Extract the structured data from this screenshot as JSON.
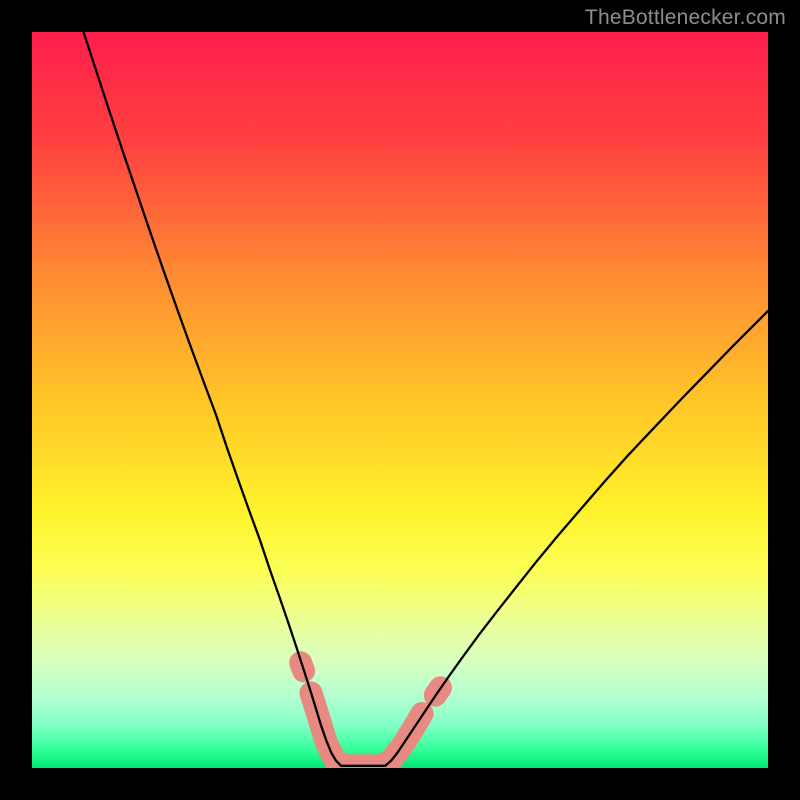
{
  "watermark": {
    "text": "TheBottlenecker.com"
  },
  "chart_data": {
    "type": "line",
    "title": "",
    "xlabel": "",
    "ylabel": "",
    "xlim": [
      0,
      100
    ],
    "ylim": [
      0,
      100
    ],
    "grid": false,
    "background": {
      "kind": "vertical-gradient",
      "stops": [
        {
          "offset": 0.0,
          "color": "#FF1E4C"
        },
        {
          "offset": 0.15,
          "color": "#FF4140"
        },
        {
          "offset": 0.33,
          "color": "#FF8A33"
        },
        {
          "offset": 0.5,
          "color": "#FFC528"
        },
        {
          "offset": 0.65,
          "color": "#FFF22A"
        },
        {
          "offset": 0.73,
          "color": "#FCFF54"
        },
        {
          "offset": 0.78,
          "color": "#F2FF82"
        },
        {
          "offset": 0.82,
          "color": "#E6FFA8"
        },
        {
          "offset": 0.86,
          "color": "#D6FFC2"
        },
        {
          "offset": 0.9,
          "color": "#B6FFD0"
        },
        {
          "offset": 0.94,
          "color": "#86FFC8"
        },
        {
          "offset": 0.975,
          "color": "#33FF99"
        },
        {
          "offset": 1.0,
          "color": "#00E676"
        }
      ]
    },
    "series": [
      {
        "name": "curve-left",
        "stroke": "#000000",
        "points": [
          {
            "x": 7.0,
            "y": 100.0
          },
          {
            "x": 8.8,
            "y": 94.5
          },
          {
            "x": 10.6,
            "y": 89.0
          },
          {
            "x": 12.4,
            "y": 83.6
          },
          {
            "x": 14.2,
            "y": 78.3
          },
          {
            "x": 16.0,
            "y": 73.0
          },
          {
            "x": 17.8,
            "y": 67.8
          },
          {
            "x": 19.6,
            "y": 62.7
          },
          {
            "x": 21.4,
            "y": 57.7
          },
          {
            "x": 23.2,
            "y": 52.8
          },
          {
            "x": 25.0,
            "y": 48.0
          },
          {
            "x": 26.5,
            "y": 43.5
          },
          {
            "x": 28.0,
            "y": 39.2
          },
          {
            "x": 29.5,
            "y": 35.0
          },
          {
            "x": 31.0,
            "y": 30.9
          },
          {
            "x": 32.3,
            "y": 27.0
          },
          {
            "x": 33.6,
            "y": 23.3
          },
          {
            "x": 34.8,
            "y": 19.8
          },
          {
            "x": 35.9,
            "y": 16.5
          },
          {
            "x": 36.9,
            "y": 13.4
          },
          {
            "x": 37.8,
            "y": 10.6
          },
          {
            "x": 38.6,
            "y": 8.0
          },
          {
            "x": 39.3,
            "y": 5.7
          },
          {
            "x": 40.0,
            "y": 3.7
          },
          {
            "x": 40.7,
            "y": 2.0
          },
          {
            "x": 41.3,
            "y": 1.0
          },
          {
            "x": 42.0,
            "y": 0.3
          }
        ]
      },
      {
        "name": "plateau",
        "stroke": "#000000",
        "points": [
          {
            "x": 42.0,
            "y": 0.3
          },
          {
            "x": 45.0,
            "y": 0.3
          },
          {
            "x": 48.0,
            "y": 0.3
          }
        ]
      },
      {
        "name": "curve-right",
        "stroke": "#000000",
        "points": [
          {
            "x": 48.0,
            "y": 0.3
          },
          {
            "x": 48.8,
            "y": 1.0
          },
          {
            "x": 49.6,
            "y": 2.0
          },
          {
            "x": 50.6,
            "y": 3.5
          },
          {
            "x": 51.8,
            "y": 5.3
          },
          {
            "x": 53.2,
            "y": 7.4
          },
          {
            "x": 54.8,
            "y": 9.8
          },
          {
            "x": 56.6,
            "y": 12.4
          },
          {
            "x": 58.6,
            "y": 15.2
          },
          {
            "x": 60.8,
            "y": 18.2
          },
          {
            "x": 63.2,
            "y": 21.3
          },
          {
            "x": 65.8,
            "y": 24.6
          },
          {
            "x": 68.5,
            "y": 28.0
          },
          {
            "x": 71.4,
            "y": 31.5
          },
          {
            "x": 74.5,
            "y": 35.1
          },
          {
            "x": 77.7,
            "y": 38.8
          },
          {
            "x": 81.0,
            "y": 42.5
          },
          {
            "x": 84.5,
            "y": 46.2
          },
          {
            "x": 88.1,
            "y": 50.0
          },
          {
            "x": 91.8,
            "y": 53.8
          },
          {
            "x": 95.5,
            "y": 57.6
          },
          {
            "x": 99.3,
            "y": 61.4
          },
          {
            "x": 100.0,
            "y": 62.1
          }
        ]
      }
    ],
    "overlays": [
      {
        "name": "pink-segments",
        "stroke": "#E88A82",
        "stroke_width": 23,
        "linecap": "round",
        "points": [
          {
            "x": 37.9,
            "y": 10.2
          },
          {
            "x": 38.9,
            "y": 7.0
          },
          {
            "x": 40.0,
            "y": 3.4
          },
          {
            "x": 41.1,
            "y": 1.2
          },
          {
            "x": 42.3,
            "y": 0.3
          },
          {
            "x": 45.0,
            "y": 0.3
          },
          {
            "x": 47.7,
            "y": 0.3
          },
          {
            "x": 49.0,
            "y": 1.3
          },
          {
            "x": 50.3,
            "y": 3.0
          },
          {
            "x": 51.7,
            "y": 5.2
          },
          {
            "x": 53.0,
            "y": 7.4
          }
        ]
      },
      {
        "name": "pink-dot-top-left",
        "stroke": "#E88A82",
        "stroke_width": 23,
        "linecap": "round",
        "points": [
          {
            "x": 36.5,
            "y": 14.3
          },
          {
            "x": 36.9,
            "y": 13.2
          }
        ]
      },
      {
        "name": "pink-dot-top-right",
        "stroke": "#E88A82",
        "stroke_width": 23,
        "linecap": "round",
        "points": [
          {
            "x": 54.8,
            "y": 9.9
          },
          {
            "x": 55.5,
            "y": 10.9
          }
        ]
      }
    ]
  }
}
